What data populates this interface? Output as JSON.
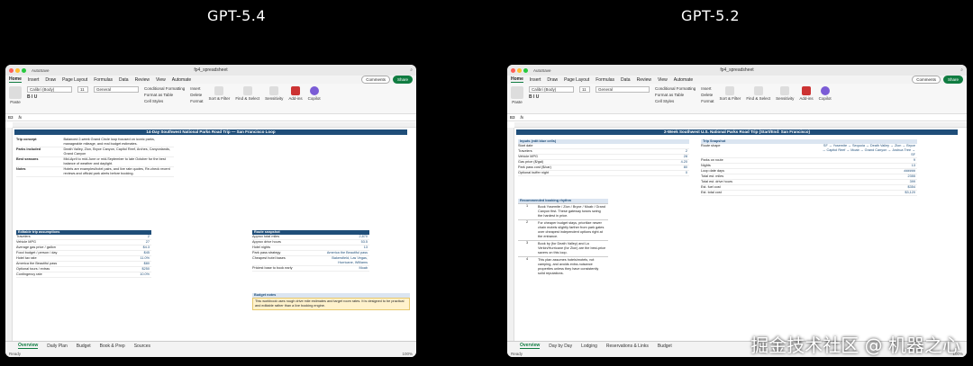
{
  "titles": {
    "left": "GPT-5.4",
    "right": "GPT-5.2"
  },
  "watermark": "掘金技术社区 @ 机器之心",
  "window": {
    "filename": "fp4_spreadsheet",
    "autosave": "AutoSave",
    "tabs": [
      "Home",
      "Insert",
      "Draw",
      "Page Layout",
      "Formulas",
      "Data",
      "Review",
      "View",
      "Automate"
    ],
    "comments": "Comments",
    "share": "Share",
    "font": "Calibri (Body)",
    "font_size": "11",
    "number_format": "General",
    "cond_format": "Conditional Formatting",
    "format_table": "Format as Table",
    "cell_styles": "Cell Styles",
    "insert": "Insert",
    "delete": "Delete",
    "format": "Format",
    "sort_filter": "Sort & Filter",
    "find_select": "Find & Select",
    "sensitivity": "Sensitivity",
    "addins": "Add-ins",
    "copilot": "Copilot",
    "paste": "Paste",
    "fx": "fx",
    "status_ready": "Ready",
    "zoom": "100%"
  },
  "left": {
    "cell_ref": "B3",
    "banner": "14-Day Southwest National Parks Road Trip — San Francisco Loop",
    "trip_concept_label": "Trip concept",
    "trip_concept": "Balanced 2-week Grand Circle loop focused on iconic parks, manageable mileage, and real budget estimates.",
    "parks_label": "Parks included",
    "parks": "Death Valley, Zion, Bryce Canyon, Capitol Reef, Arches, Canyonlands, Grand Canyon",
    "season_label": "Best seasons",
    "season": "Mid-April to mid-June or mid-September to late October for the best balance of weather and daylight.",
    "notes_label": "Notes",
    "notes": "Hotels are examples/hotel pairs, and live rate quotes, Re-check recent reviews and official park alerts before booking.",
    "assumptions_hdr": "Editable trip assumptions",
    "assumptions": [
      {
        "k": "Travelers",
        "v": "2"
      },
      {
        "k": "Vehicle MPG",
        "v": "27"
      },
      {
        "k": "Average gas price / gallon",
        "v": "$4.3"
      },
      {
        "k": "Food budget / person / day",
        "v": "$45"
      },
      {
        "k": "Hotel tax rate",
        "v": "11.0%"
      },
      {
        "k": "America the Beautiful pass",
        "v": "$80"
      },
      {
        "k": "Optional tours / extras",
        "v": "$250"
      },
      {
        "k": "Contingency rate",
        "v": "10.0%"
      }
    ],
    "snapshot_hdr": "Route snapshot",
    "snapshot": [
      {
        "k": "Approx total miles",
        "v": "2,870"
      },
      {
        "k": "Approx drive hours",
        "v": "53.5"
      },
      {
        "k": "Hotel nights",
        "v": "13"
      },
      {
        "k": "Park pass strategy",
        "v": "America the Beautiful pass"
      },
      {
        "k": "Cheapest hotel bases",
        "v": "Bakersfield, Las Vegas, Hurricane, Williams"
      },
      {
        "k": "Priciest base to book early",
        "v": "Moab"
      }
    ],
    "budget_note_hdr": "Budget notes",
    "budget_note": "This workbook uses rough drive mile estimates and target room rates. It is designed to be practical and editable rather than a live booking engine.",
    "sheet_tabs": [
      "Overview",
      "Daily Plan",
      "Budget",
      "Book & Prep",
      "Sources"
    ]
  },
  "right": {
    "cell_ref": "B3",
    "banner": "2-Week Southwest U.S. National Parks Road Trip (Start/End: San Francisco)",
    "inputs_hdr": "Inputs (edit blue cells)",
    "inputs": [
      {
        "k": "Start date",
        "v": ""
      },
      {
        "k": "Travelers",
        "v": "2"
      },
      {
        "k": "Vehicle MPG",
        "v": "28"
      },
      {
        "k": "Gas price ($/gal)",
        "v": "4.20"
      },
      {
        "k": "Park pass cost ($/car)",
        "v": "80"
      },
      {
        "k": "Optional buffer night",
        "v": "0"
      }
    ],
    "snapshot_hdr": "Trip Snapshot",
    "snapshot": [
      {
        "k": "Route shape",
        "v": "SF → Yosemite → Sequoia → Death Valley → Zion → Bryce → Capitol Reef → Moab → Grand Canyon → Joshua Tree → SF"
      },
      {
        "k": "Parks on route",
        "v": "9"
      },
      {
        "k": "Nights",
        "v": "13"
      },
      {
        "k": "Loop date days",
        "v": "###### "
      },
      {
        "k": "Total est. miles",
        "v": "2355"
      },
      {
        "k": "Total est. drive hours",
        "v": "399"
      },
      {
        "k": "Est. fuel cost",
        "v": "$354"
      },
      {
        "k": "Est. total cost",
        "v": "$3,120"
      }
    ],
    "rec_hdr": "Recommended booking rhythm",
    "rec": [
      {
        "n": "1",
        "t": "Book Yosemite / Zion / Bryce / Moab / Grand Canyon first. These gateway towns swing the hardest in price."
      },
      {
        "n": "2",
        "t": "For cheaper budget stays, prioritize newer chain motels slightly farther from park gates over cheapest independent options right at the entrance."
      },
      {
        "n": "3",
        "t": "Book by (for Death Valley) and La Verkin/Hurricane (for Zion) are the best-price savers on this loop."
      },
      {
        "n": "4",
        "t": "This plan assumes hotels/motels, not camping, and avoids extra-nuisance properties unless they have consistently solid reputations."
      }
    ],
    "sheet_tabs": [
      "Overview",
      "Day by Day",
      "Lodging",
      "Reservations & Links",
      "Budget"
    ]
  }
}
